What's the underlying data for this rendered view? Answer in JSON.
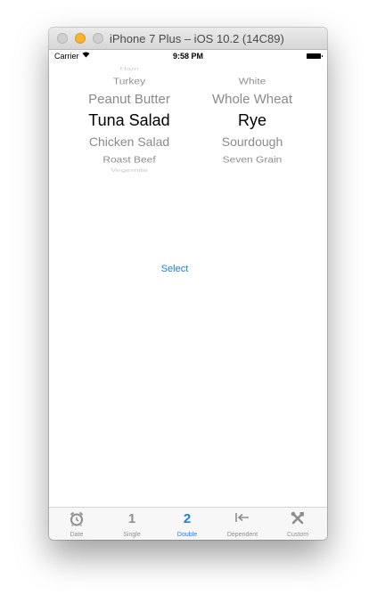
{
  "window": {
    "title": "iPhone 7 Plus – iOS 10.2 (14C89)"
  },
  "status_bar": {
    "carrier": "Carrier",
    "time": "9:58 PM"
  },
  "picker": {
    "fillings": [
      "Ham",
      "Turkey",
      "Peanut Butter",
      "Tuna Salad",
      "Chicken Salad",
      "Roast Beef",
      "Vegemite"
    ],
    "breads": [
      "White",
      "Whole Wheat",
      "Rye",
      "Sourdough",
      "Seven Grain"
    ],
    "selected_filling": "Tuna Salad",
    "selected_bread": "Rye"
  },
  "select_button": {
    "label": "Select"
  },
  "tab_bar": {
    "active": "Double",
    "items": [
      {
        "label": "Date",
        "icon": "alarm-clock-icon"
      },
      {
        "label": "Single",
        "glyph": "1"
      },
      {
        "label": "Double",
        "glyph": "2"
      },
      {
        "label": "Dependent",
        "icon": "arrow-left-bar-icon"
      },
      {
        "label": "Custom",
        "icon": "tools-icon"
      }
    ]
  },
  "colors": {
    "accent": "#1a7cf3",
    "inactive": "#8e8e8e",
    "tab_bar_bg": "#f7f7f7"
  }
}
